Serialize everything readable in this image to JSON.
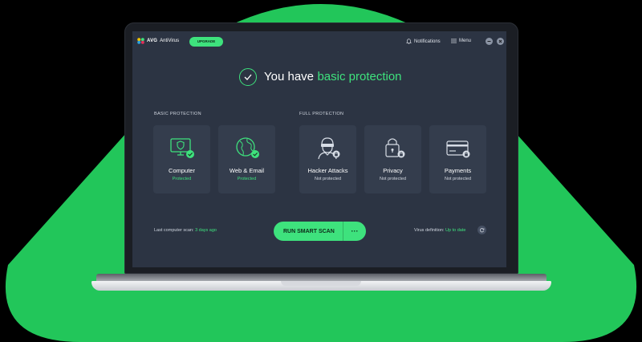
{
  "app": {
    "brand": "AVG",
    "product": "AntiVirus",
    "upgrade_label": "UPGRADE",
    "notifications_label": "Notifications",
    "menu_label": "Menu"
  },
  "headline": {
    "prefix": "You have",
    "accent": "basic protection"
  },
  "sections": {
    "basic_label": "BASIC PROTECTION",
    "full_label": "FULL PROTECTION"
  },
  "cards": [
    {
      "title": "Computer",
      "status": "Protected",
      "icon": "monitor-shield-icon",
      "state": "protected"
    },
    {
      "title": "Web & Email",
      "status": "Protected",
      "icon": "globe-icon",
      "state": "protected"
    },
    {
      "title": "Hacker Attacks",
      "status": "Not protected",
      "icon": "hacker-icon",
      "state": "locked"
    },
    {
      "title": "Privacy",
      "status": "Not protected",
      "icon": "padlock-icon",
      "state": "locked"
    },
    {
      "title": "Payments",
      "status": "Not protected",
      "icon": "credit-card-icon",
      "state": "locked"
    }
  ],
  "footer": {
    "last_scan_label": "Last computer scan:",
    "last_scan_value": "3 days ago",
    "scan_button_label": "RUN SMART SCAN",
    "scan_more_label": "···",
    "virus_def_label": "Virus definition:",
    "virus_def_value": "Up to date"
  },
  "colors": {
    "accent": "#3ee27d",
    "panel": "#2c3443",
    "card": "#343d4d",
    "backdrop_blob": "#22c65a"
  }
}
